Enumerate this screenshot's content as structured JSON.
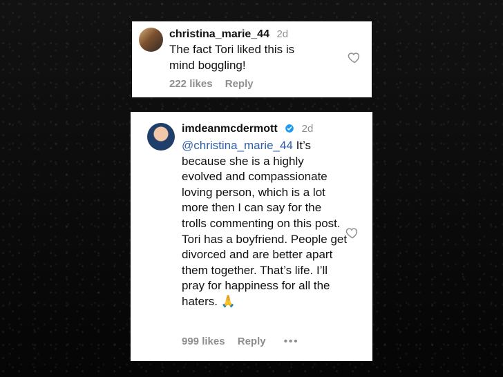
{
  "comments": [
    {
      "username": "christina_marie_44",
      "time": "2d",
      "text": "The fact Tori liked this is mind boggling!",
      "likes": "222 likes",
      "reply": "Reply"
    },
    {
      "username": "imdeanmcdermott",
      "time": "2d",
      "mention": "@christina_marie_44",
      "text": " It’s because she is a highly evolved and compassionate loving person, which is a lot more then I can say for the trolls commenting on this post. Tori has a boyfriend. People get divorced and are better apart them together. That’s life. I’ll pray for happiness for all the haters. 🙏",
      "likes": "999 likes",
      "reply": "Reply",
      "more": "•••"
    }
  ],
  "colors": {
    "background": "#0b0b0b",
    "card": "#ffffff",
    "text": "#111111",
    "muted": "#8e8e8e",
    "mention": "#2f5fa8",
    "verified": "#1d9bf0"
  },
  "icons": {
    "heart": "heart-icon",
    "verified": "verified-badge-icon",
    "more": "more-options-icon"
  }
}
